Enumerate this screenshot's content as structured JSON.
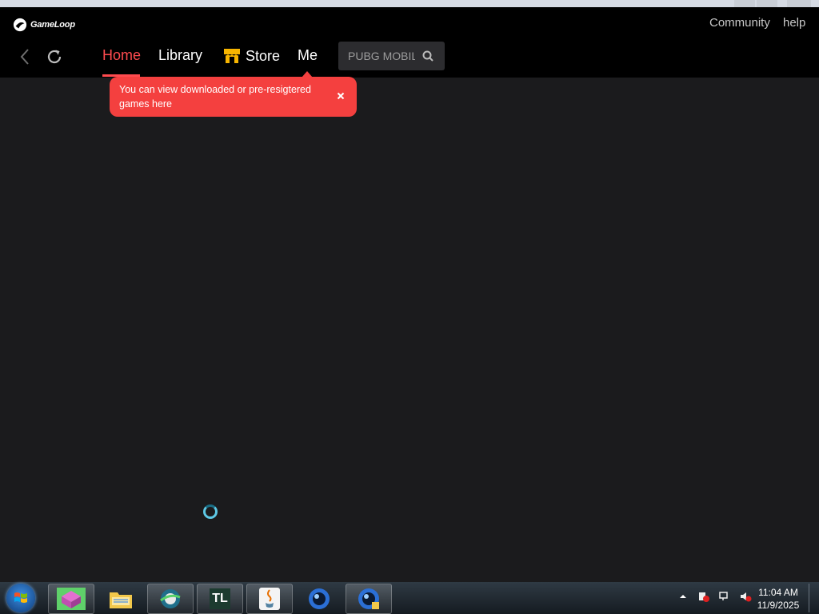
{
  "app": {
    "brand": "GameLoop",
    "top_links": {
      "community": "Community",
      "help": "help"
    }
  },
  "nav": {
    "tabs": [
      {
        "label": "Home",
        "active": true
      },
      {
        "label": "Library",
        "active": false
      },
      {
        "label": "Store",
        "active": false
      },
      {
        "label": "Me",
        "active": false
      }
    ],
    "search": {
      "placeholder": "PUBG MOBILE"
    }
  },
  "tooltip": {
    "text": "You can view downloaded or pre-resigtered games here"
  },
  "colors": {
    "accent": "#ff4b4f",
    "tooltip_bg": "#f4403f",
    "background": "#1b1b1d",
    "topbar": "#000000"
  },
  "taskbar": {
    "apps": [
      "start-orb",
      "pink-app",
      "file-explorer",
      "browser-globe",
      "tl-app",
      "java",
      "gameloop-a",
      "gameloop-b"
    ],
    "clock": {
      "time": "11:04 AM",
      "date": "11/9/2025"
    }
  }
}
